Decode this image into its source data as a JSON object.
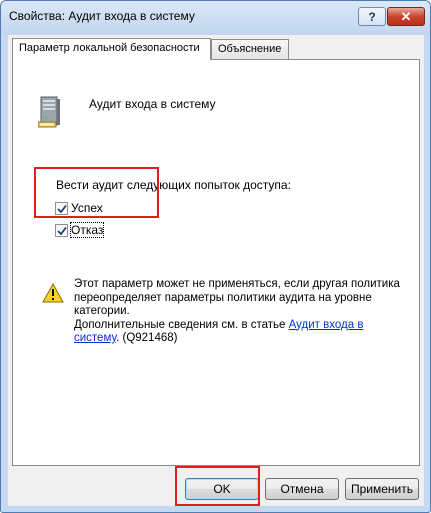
{
  "window": {
    "title": "Свойства: Аудит входа в систему",
    "help_label": "?",
    "close_label": "✕"
  },
  "tabs": [
    {
      "label": "Параметр локальной безопасности",
      "active": true
    },
    {
      "label": "Объяснение",
      "active": false
    }
  ],
  "policy": {
    "icon": "server-icon",
    "name": "Аудит входа в систему"
  },
  "audit": {
    "group_label": "Вести аудит следующих попыток доступа:",
    "options": [
      {
        "label": "Успех",
        "checked": true
      },
      {
        "label": "Отказ",
        "checked": true
      }
    ]
  },
  "warning": {
    "icon": "warning-icon",
    "text": "Этот параметр может не применяться, если другая политика переопределяет параметры политики аудита на уровне категории.",
    "more_prefix": "Дополнительные сведения см. в статье ",
    "link_text": "Аудит входа в систему",
    "suffix": ". (Q921468)"
  },
  "buttons": {
    "ok": "OK",
    "cancel": "Отмена",
    "apply": "Применить"
  },
  "colors": {
    "highlight": "#e01e1e",
    "link": "#0033cc"
  }
}
